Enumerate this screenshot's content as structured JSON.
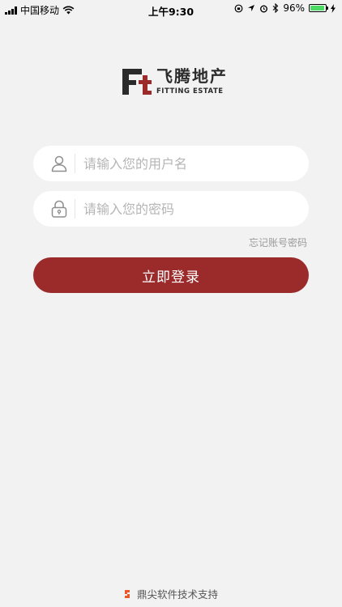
{
  "status_bar": {
    "carrier": "中国移动",
    "time": "上午9:30",
    "battery_percent": "96%",
    "battery_level": 0.96,
    "battery_color": "#4cd964"
  },
  "logo": {
    "name_cn": "飞腾地产",
    "name_en": "FITTING ESTATE",
    "icon": "ft-logo-mark",
    "accent_color": "#9b2b2b"
  },
  "form": {
    "username": {
      "placeholder": "请输入您的用户名",
      "value": "",
      "icon": "user-icon"
    },
    "password": {
      "placeholder": "请输入您的密码",
      "value": "",
      "icon": "lock-icon"
    },
    "forgot_label": "忘记账号密码",
    "submit_label": "立即登录"
  },
  "footer": {
    "text": "鼎尖软件技术支持",
    "icon": "dingjian-logo-icon"
  },
  "theme": {
    "background": "#f2f2f2",
    "primary_button": "#9b2b2b"
  }
}
